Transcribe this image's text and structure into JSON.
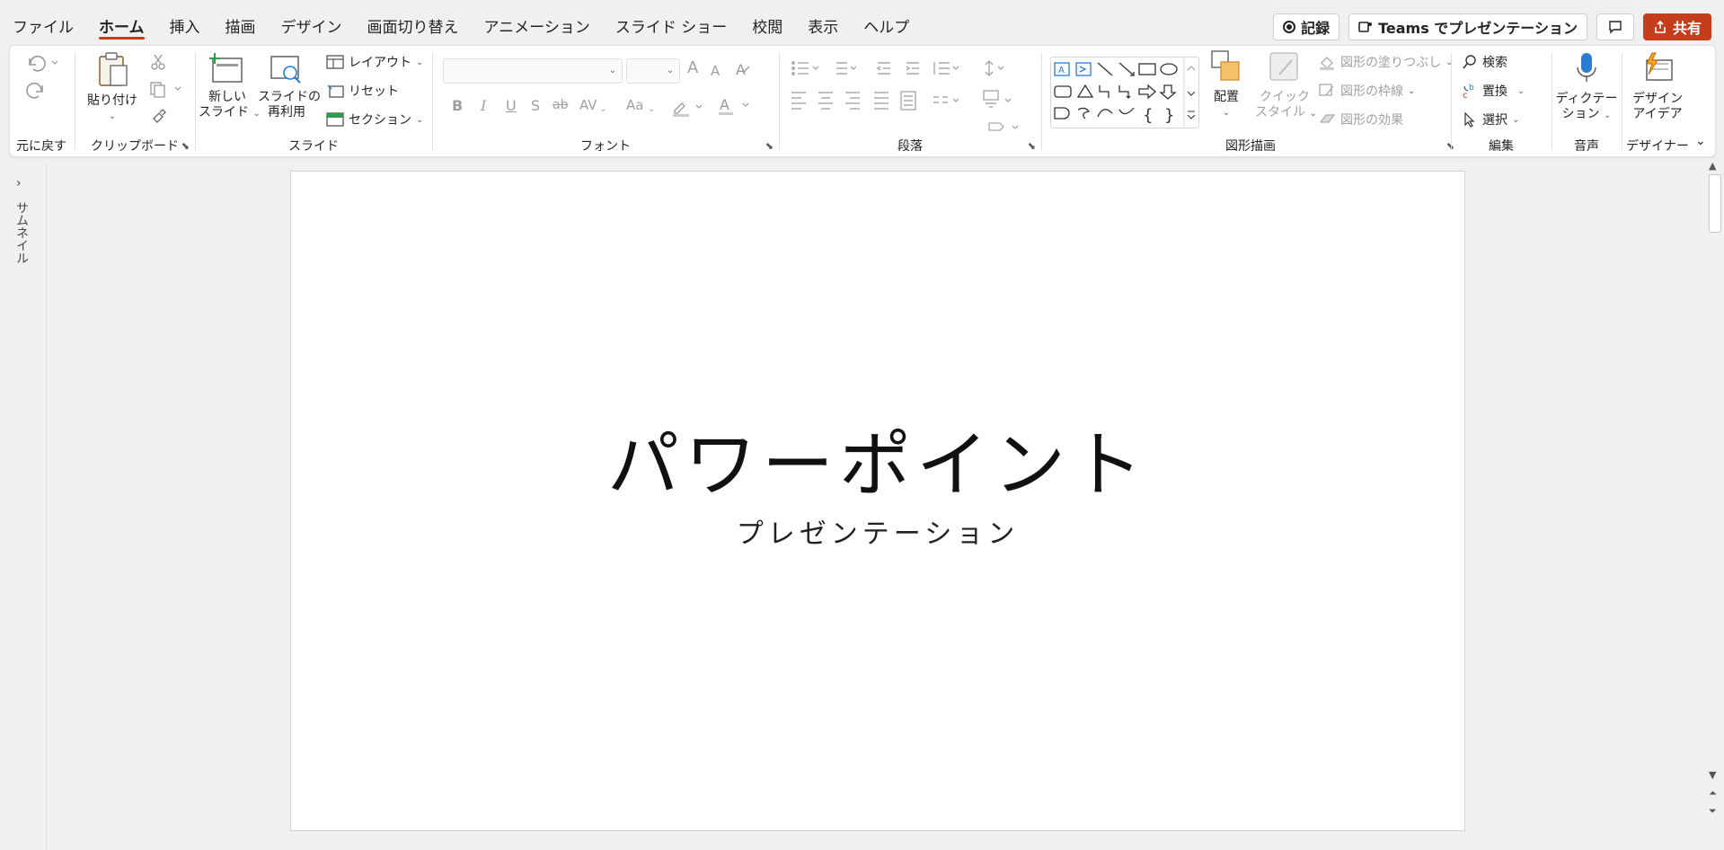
{
  "menu": {
    "tabs": [
      "ファイル",
      "ホーム",
      "挿入",
      "描画",
      "デザイン",
      "画面切り替え",
      "アニメーション",
      "スライド ショー",
      "校閲",
      "表示",
      "ヘルプ"
    ],
    "active_tab": "ホーム",
    "record_label": "記録",
    "teams_label": "Teams でプレゼンテーション",
    "share_label": "共有"
  },
  "ribbon": {
    "undo": {
      "group_label": "元に戻す"
    },
    "clipboard": {
      "paste_line1": "貼り付け",
      "group_label": "クリップボード"
    },
    "slides": {
      "new_slide_line1": "新しい",
      "new_slide_line2": "スライド",
      "reuse_line1": "スライドの",
      "reuse_line2": "再利用",
      "layout": "レイアウト",
      "reset": "リセット",
      "section": "セクション",
      "group_label": "スライド"
    },
    "font": {
      "group_label": "フォント",
      "bold": "B",
      "italic": "I",
      "underline": "U",
      "strike": "S",
      "strike2": "ab",
      "spacing": "AV",
      "case": "Aa",
      "grow": "A",
      "shrink": "A"
    },
    "paragraph": {
      "group_label": "段落"
    },
    "drawing": {
      "arrange": "配置",
      "quick_line1": "クイック",
      "quick_line2": "スタイル",
      "fill": "図形の塗りつぶし",
      "outline": "図形の枠線",
      "effects": "図形の効果",
      "group_label": "図形描画"
    },
    "editing": {
      "find": "検索",
      "replace": "置換",
      "select": "選択",
      "group_label": "編集"
    },
    "voice": {
      "dictate_line1": "ディクテー",
      "dictate_line2": "ション",
      "group_label": "音声"
    },
    "designer": {
      "ideas_line1": "デザイン",
      "ideas_line2": "アイデア",
      "group_label": "デザイナー"
    }
  },
  "sidebar": {
    "label": "サムネイル"
  },
  "slide": {
    "title": "パワーポイント",
    "subtitle": "プレゼンテーション"
  }
}
